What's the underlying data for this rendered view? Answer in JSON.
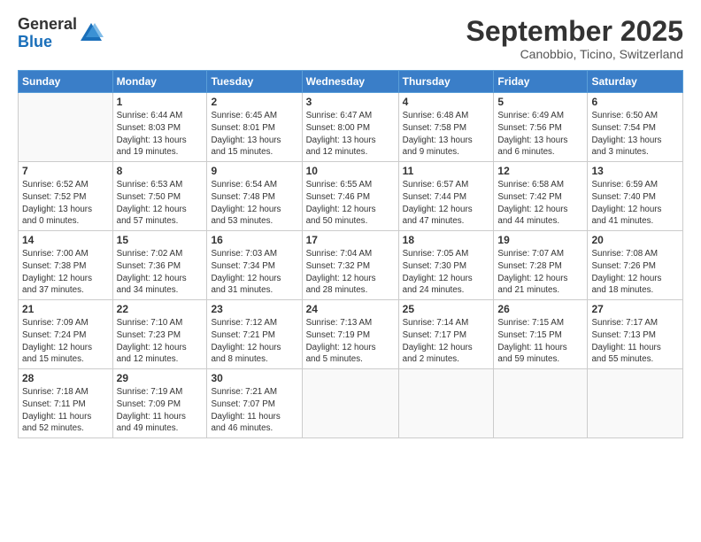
{
  "logo": {
    "general": "General",
    "blue": "Blue"
  },
  "header": {
    "month": "September 2025",
    "location": "Canobbio, Ticino, Switzerland"
  },
  "weekdays": [
    "Sunday",
    "Monday",
    "Tuesday",
    "Wednesday",
    "Thursday",
    "Friday",
    "Saturday"
  ],
  "weeks": [
    [
      {
        "day": "",
        "info": ""
      },
      {
        "day": "1",
        "info": "Sunrise: 6:44 AM\nSunset: 8:03 PM\nDaylight: 13 hours\nand 19 minutes."
      },
      {
        "day": "2",
        "info": "Sunrise: 6:45 AM\nSunset: 8:01 PM\nDaylight: 13 hours\nand 15 minutes."
      },
      {
        "day": "3",
        "info": "Sunrise: 6:47 AM\nSunset: 8:00 PM\nDaylight: 13 hours\nand 12 minutes."
      },
      {
        "day": "4",
        "info": "Sunrise: 6:48 AM\nSunset: 7:58 PM\nDaylight: 13 hours\nand 9 minutes."
      },
      {
        "day": "5",
        "info": "Sunrise: 6:49 AM\nSunset: 7:56 PM\nDaylight: 13 hours\nand 6 minutes."
      },
      {
        "day": "6",
        "info": "Sunrise: 6:50 AM\nSunset: 7:54 PM\nDaylight: 13 hours\nand 3 minutes."
      }
    ],
    [
      {
        "day": "7",
        "info": "Sunrise: 6:52 AM\nSunset: 7:52 PM\nDaylight: 13 hours\nand 0 minutes."
      },
      {
        "day": "8",
        "info": "Sunrise: 6:53 AM\nSunset: 7:50 PM\nDaylight: 12 hours\nand 57 minutes."
      },
      {
        "day": "9",
        "info": "Sunrise: 6:54 AM\nSunset: 7:48 PM\nDaylight: 12 hours\nand 53 minutes."
      },
      {
        "day": "10",
        "info": "Sunrise: 6:55 AM\nSunset: 7:46 PM\nDaylight: 12 hours\nand 50 minutes."
      },
      {
        "day": "11",
        "info": "Sunrise: 6:57 AM\nSunset: 7:44 PM\nDaylight: 12 hours\nand 47 minutes."
      },
      {
        "day": "12",
        "info": "Sunrise: 6:58 AM\nSunset: 7:42 PM\nDaylight: 12 hours\nand 44 minutes."
      },
      {
        "day": "13",
        "info": "Sunrise: 6:59 AM\nSunset: 7:40 PM\nDaylight: 12 hours\nand 41 minutes."
      }
    ],
    [
      {
        "day": "14",
        "info": "Sunrise: 7:00 AM\nSunset: 7:38 PM\nDaylight: 12 hours\nand 37 minutes."
      },
      {
        "day": "15",
        "info": "Sunrise: 7:02 AM\nSunset: 7:36 PM\nDaylight: 12 hours\nand 34 minutes."
      },
      {
        "day": "16",
        "info": "Sunrise: 7:03 AM\nSunset: 7:34 PM\nDaylight: 12 hours\nand 31 minutes."
      },
      {
        "day": "17",
        "info": "Sunrise: 7:04 AM\nSunset: 7:32 PM\nDaylight: 12 hours\nand 28 minutes."
      },
      {
        "day": "18",
        "info": "Sunrise: 7:05 AM\nSunset: 7:30 PM\nDaylight: 12 hours\nand 24 minutes."
      },
      {
        "day": "19",
        "info": "Sunrise: 7:07 AM\nSunset: 7:28 PM\nDaylight: 12 hours\nand 21 minutes."
      },
      {
        "day": "20",
        "info": "Sunrise: 7:08 AM\nSunset: 7:26 PM\nDaylight: 12 hours\nand 18 minutes."
      }
    ],
    [
      {
        "day": "21",
        "info": "Sunrise: 7:09 AM\nSunset: 7:24 PM\nDaylight: 12 hours\nand 15 minutes."
      },
      {
        "day": "22",
        "info": "Sunrise: 7:10 AM\nSunset: 7:23 PM\nDaylight: 12 hours\nand 12 minutes."
      },
      {
        "day": "23",
        "info": "Sunrise: 7:12 AM\nSunset: 7:21 PM\nDaylight: 12 hours\nand 8 minutes."
      },
      {
        "day": "24",
        "info": "Sunrise: 7:13 AM\nSunset: 7:19 PM\nDaylight: 12 hours\nand 5 minutes."
      },
      {
        "day": "25",
        "info": "Sunrise: 7:14 AM\nSunset: 7:17 PM\nDaylight: 12 hours\nand 2 minutes."
      },
      {
        "day": "26",
        "info": "Sunrise: 7:15 AM\nSunset: 7:15 PM\nDaylight: 11 hours\nand 59 minutes."
      },
      {
        "day": "27",
        "info": "Sunrise: 7:17 AM\nSunset: 7:13 PM\nDaylight: 11 hours\nand 55 minutes."
      }
    ],
    [
      {
        "day": "28",
        "info": "Sunrise: 7:18 AM\nSunset: 7:11 PM\nDaylight: 11 hours\nand 52 minutes."
      },
      {
        "day": "29",
        "info": "Sunrise: 7:19 AM\nSunset: 7:09 PM\nDaylight: 11 hours\nand 49 minutes."
      },
      {
        "day": "30",
        "info": "Sunrise: 7:21 AM\nSunset: 7:07 PM\nDaylight: 11 hours\nand 46 minutes."
      },
      {
        "day": "",
        "info": ""
      },
      {
        "day": "",
        "info": ""
      },
      {
        "day": "",
        "info": ""
      },
      {
        "day": "",
        "info": ""
      }
    ]
  ]
}
